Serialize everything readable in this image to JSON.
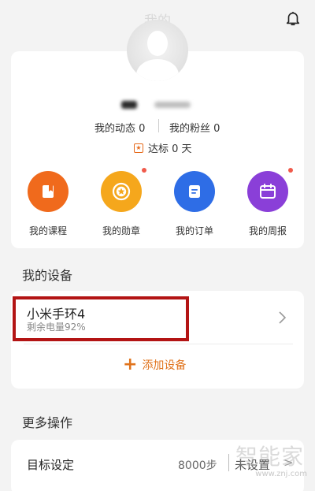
{
  "header": {
    "title": "我的"
  },
  "profile": {
    "dynamics_label": "我的动态",
    "dynamics_count": "0",
    "fans_label": "我的粉丝",
    "fans_count": "0",
    "goal_text": "达标 0 天"
  },
  "shortcuts": [
    {
      "label": "我的课程",
      "color": "#f06a1c",
      "icon": "course-book-icon",
      "dot": false
    },
    {
      "label": "我的勋章",
      "color": "#f5a71c",
      "icon": "medal-icon",
      "dot": true
    },
    {
      "label": "我的订单",
      "color": "#2e6de6",
      "icon": "order-icon",
      "dot": false
    },
    {
      "label": "我的周报",
      "color": "#8a3fd8",
      "icon": "weekly-report-icon",
      "dot": true
    }
  ],
  "devices": {
    "section_title": "我的设备",
    "items": [
      {
        "name": "小米手环4",
        "battery": "剩余电量92%"
      }
    ],
    "add_label": "添加设备"
  },
  "more": {
    "section_title": "更多操作",
    "target": {
      "label": "目标设定",
      "value": "8000步",
      "state": "未设置"
    }
  },
  "watermark": {
    "brand": "智能家",
    "url": "www.znj.com"
  },
  "colors": {
    "accent": "#e0731c",
    "highlight_border": "#b31414",
    "badge_dot": "#f05a4b"
  }
}
